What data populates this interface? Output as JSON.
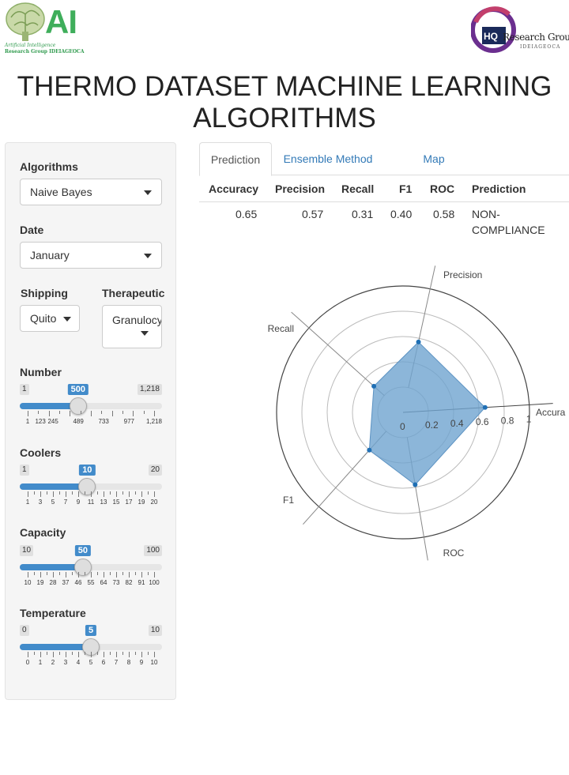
{
  "header": {
    "left_logo": {
      "text": "AI",
      "line1": "Artificial Intelligence",
      "line2": "Research Group IDEIAGEOCA"
    },
    "right_logo": {
      "text": "Research Group",
      "sub": "IDEIAGEOCA"
    },
    "title": "THERMO DATASET MACHINE LEARNING ALGORITHMS"
  },
  "sidebar": {
    "algorithms": {
      "label": "Algorithms",
      "value": "Naive Bayes"
    },
    "date": {
      "label": "Date",
      "value": "January"
    },
    "shipping": {
      "label": "Shipping",
      "value": "Quito"
    },
    "therapeutic": {
      "label": "Therapeutic",
      "value": "Granulocy"
    },
    "number": {
      "label": "Number",
      "min": "1",
      "max": "1,218",
      "value": "500",
      "fraction": 0.41,
      "ticks": [
        "1",
        "123",
        "245",
        "489",
        "733",
        "977",
        "1,218"
      ]
    },
    "coolers": {
      "label": "Coolers",
      "min": "1",
      "max": "20",
      "value": "10",
      "fraction": 0.474,
      "ticks": [
        "1",
        "3",
        "5",
        "7",
        "9",
        "11",
        "13",
        "15",
        "17",
        "19",
        "20"
      ]
    },
    "capacity": {
      "label": "Capacity",
      "min": "10",
      "max": "100",
      "value": "50",
      "fraction": 0.444,
      "ticks": [
        "10",
        "19",
        "28",
        "37",
        "46",
        "55",
        "64",
        "73",
        "82",
        "91",
        "100"
      ]
    },
    "temperature": {
      "label": "Temperature",
      "min": "0",
      "max": "10",
      "value": "5",
      "fraction": 0.5,
      "ticks": [
        "0",
        "1",
        "2",
        "3",
        "4",
        "5",
        "6",
        "7",
        "8",
        "9",
        "10"
      ]
    }
  },
  "tabs": [
    {
      "label": "Prediction",
      "active": true
    },
    {
      "label": "Ensemble Method",
      "active": false
    },
    {
      "label": "Map",
      "active": false
    }
  ],
  "table": {
    "headers": [
      "Accuracy",
      "Precision",
      "Recall",
      "F1",
      "ROC",
      "Prediction"
    ],
    "row": [
      "0.65",
      "0.57",
      "0.31",
      "0.40",
      "0.58",
      "NON-",
      "COMPLIANCE"
    ]
  },
  "chart_data": {
    "type": "radar",
    "axes": [
      "Accuracy",
      "Precision",
      "Recall",
      "F1",
      "ROC"
    ],
    "axis_labels_shown": [
      "Accura",
      "Precision",
      "Recall",
      "F1",
      "ROC"
    ],
    "values": [
      0.65,
      0.57,
      0.31,
      0.4,
      0.58
    ],
    "radial_ticks": [
      "0",
      "0.2",
      "0.4",
      "0.6",
      "0.8",
      "1"
    ],
    "range": [
      0,
      1
    ],
    "fill_color": "#6fa4cf",
    "point_color": "#1f6fb4"
  }
}
